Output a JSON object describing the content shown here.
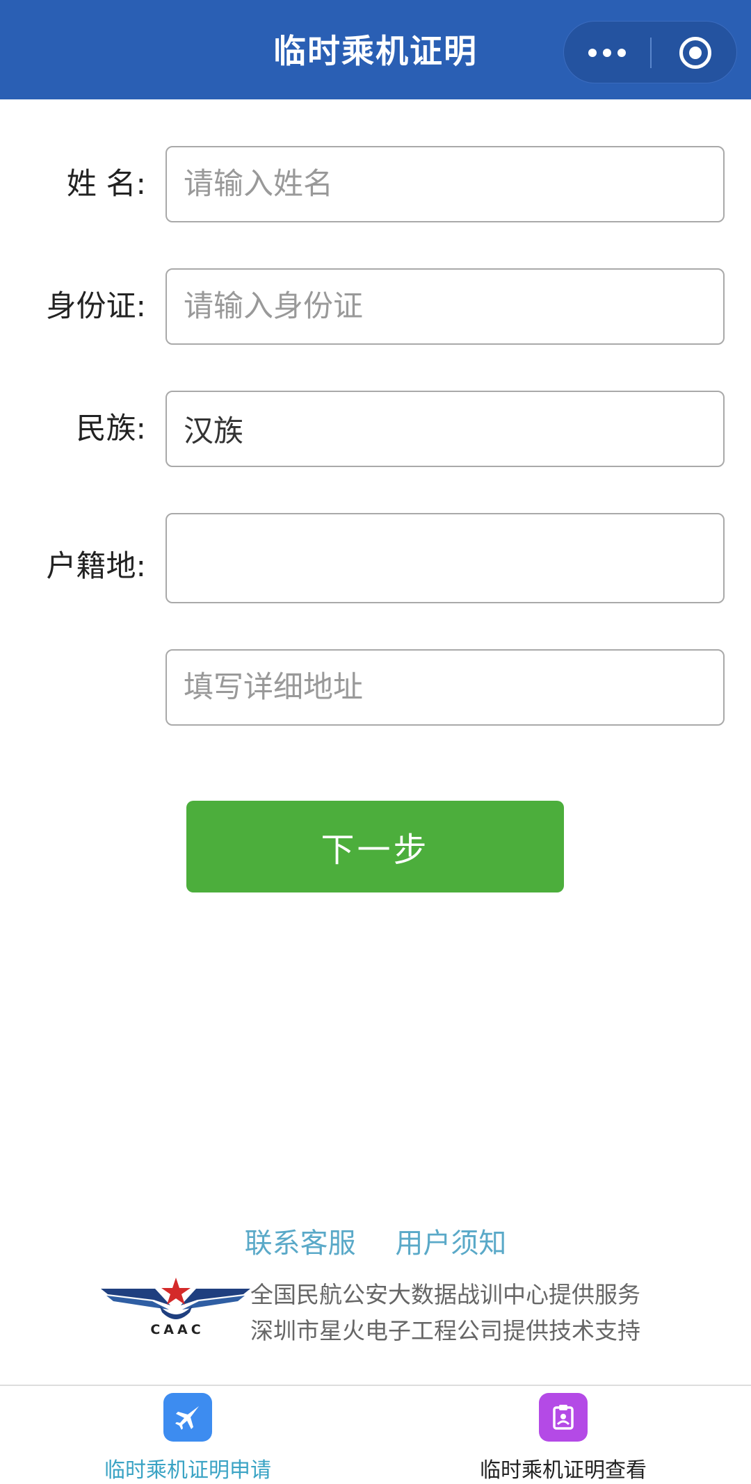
{
  "header": {
    "title": "临时乘机证明",
    "menu_icon": "more-dots-icon",
    "close_icon": "target-circle-icon"
  },
  "form": {
    "name": {
      "label": "姓  名:",
      "placeholder": "请输入姓名",
      "value": ""
    },
    "id_card": {
      "label": "身份证:",
      "placeholder": "请输入身份证",
      "value": ""
    },
    "ethnicity": {
      "label": "民族:",
      "placeholder": "",
      "value": "汉族"
    },
    "household": {
      "label": "户籍地:",
      "placeholder": "",
      "value": ""
    },
    "address": {
      "label": "",
      "placeholder": "填写详细地址",
      "value": ""
    }
  },
  "next_button": {
    "label": "下一步"
  },
  "footer": {
    "links": [
      "联系客服",
      "用户须知"
    ],
    "logo_text": "CAAC",
    "service_lines": [
      "全国民航公安大数据战训中心提供服务",
      "深圳市星火电子工程公司提供技术支持"
    ]
  },
  "tabbar": {
    "tabs": [
      {
        "label": "临时乘机证明申请",
        "icon": "airplane-icon",
        "active": true
      },
      {
        "label": "临时乘机证明查看",
        "icon": "clipboard-icon",
        "active": false
      }
    ]
  },
  "colors": {
    "header_bg": "#2a5fb4",
    "button_green": "#4cae3c",
    "link_blue": "#5aa9c8",
    "tab_active_text": "#3aa3c4",
    "tab_icon_blue": "#3d8cf0",
    "tab_icon_purple": "#b44ae6"
  }
}
